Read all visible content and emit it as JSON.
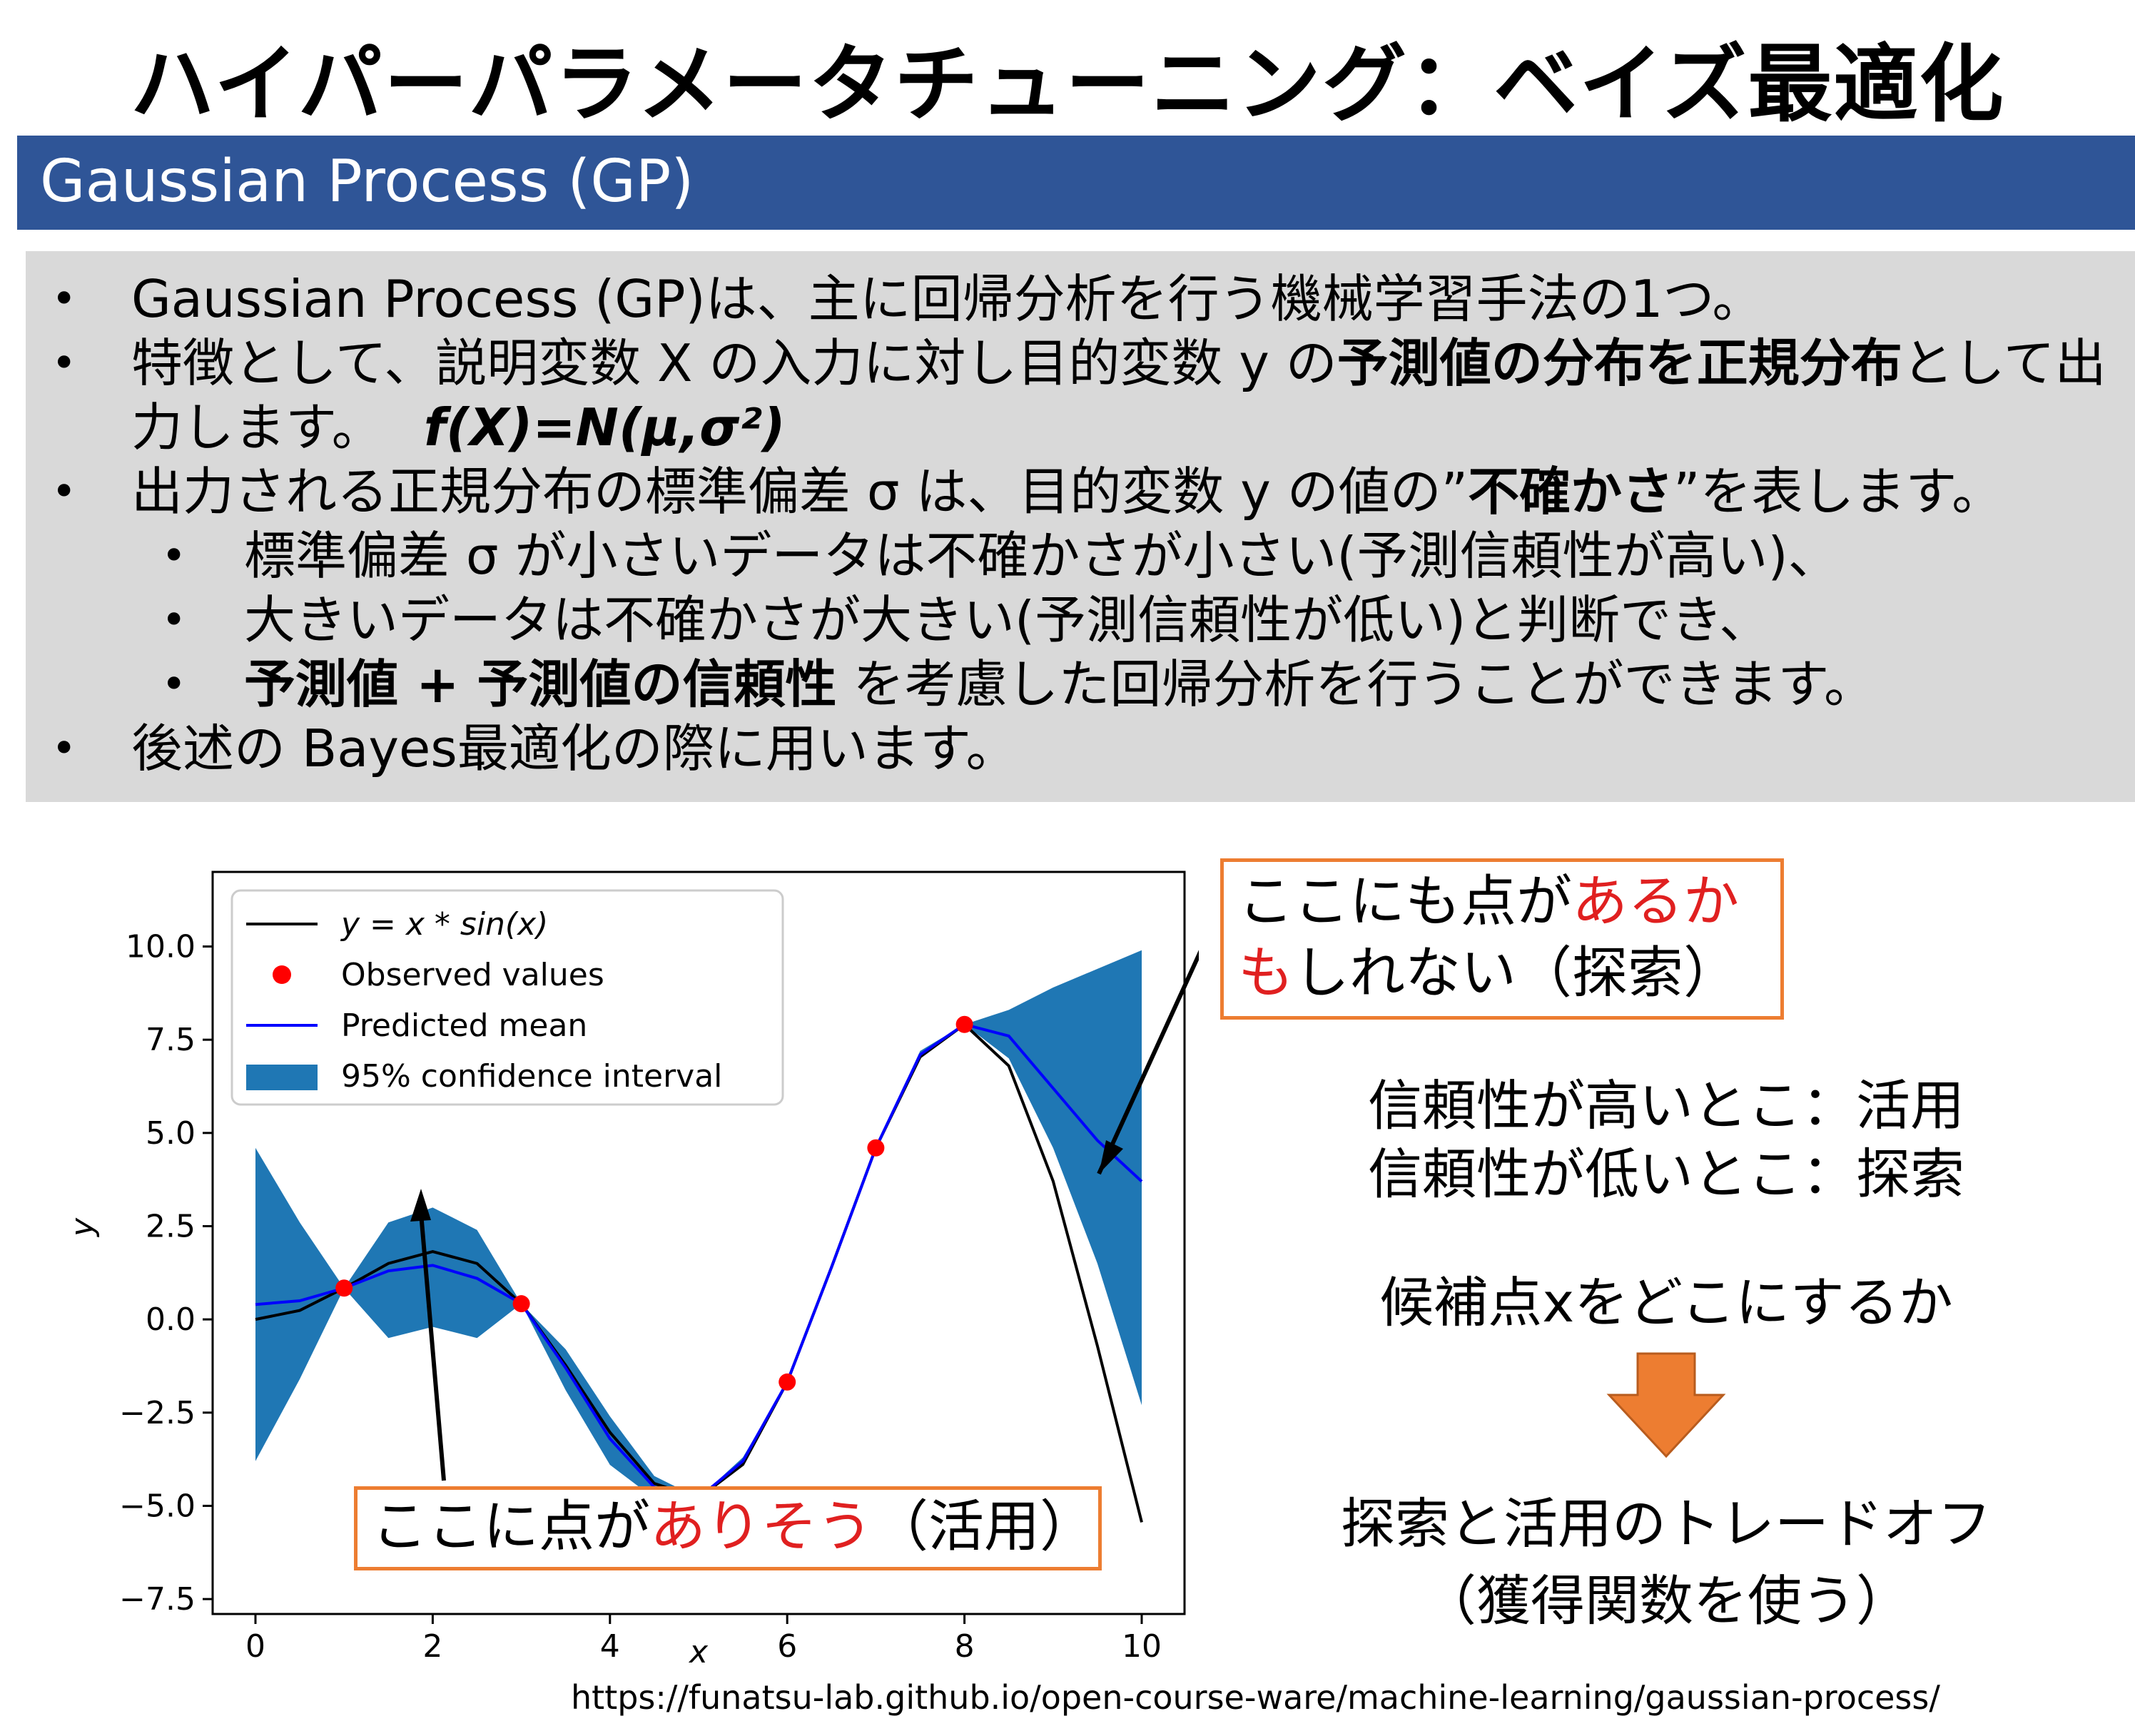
{
  "title": "ハイパーパラメータチューニング：ベイズ最適化",
  "section_title": "Gaussian Process (GP)",
  "bullets": {
    "b1": "Gaussian Process (GP)は、主に回帰分析を行う機械学習手法の1つ。",
    "b2_pre": "特徴として、説明変数 X の入力に対し目的変数 y の",
    "b2_bold": "予測値の分布を正規分布",
    "b2_post": "として出",
    "b2_line2_pre": "力します。",
    "b2_formula": "f(X)=N(μ,σ²)",
    "b3_pre": "出力される正規分布の標準偏差 σ は、目的変数 y の値の”",
    "b3_bold": "不確かさ",
    "b3_post": "”を表します。",
    "s1": "標準偏差 σ が小さいデータは不確かさが小さい(予測信頼性が高い)、",
    "s2": "大きいデータは不確かさが大きい(予測信頼性が低い)と判断でき、",
    "s3_bold": "予測値 + 予測値の信頼性",
    "s3_post": " を考慮した回帰分析を行うことができます。",
    "b4": "後述の Bayes最適化の際に用います。",
    "bullet_char": "•"
  },
  "annotations": {
    "explore_pre": "ここにも点が",
    "explore_red1": "あるか",
    "explore_red2": "も",
    "explore_post": "しれない（探索）",
    "exploit_pre": "ここに点が",
    "exploit_red": "ありそう",
    "exploit_post": "（活用）"
  },
  "side_text": {
    "line1": "信頼性が高いとこ：活用",
    "line2": "信頼性が低いとこ：探索",
    "question": "候補点xをどこにするか",
    "tradeoff": "探索と活用のトレードオフ",
    "acq": "（獲得関数を使う）"
  },
  "url": "https://funatsu-lab.github.io/open-course-ware/machine-learning/gaussian-process/",
  "colors": {
    "header_bar": "#2f5597",
    "bullet_bg": "#d9d9d9",
    "accent_orange": "#ed7d31",
    "highlight_red": "#e02020",
    "ci_fill": "#1f77b4",
    "mean_line": "#0000ff",
    "obs_dot": "#ff0000"
  },
  "chart_data": {
    "type": "line",
    "xlabel": "x",
    "ylabel": "y",
    "xlim": [
      0,
      10
    ],
    "ylim": [
      -7.9,
      12
    ],
    "xticks": [
      "0",
      "2",
      "4",
      "6",
      "8",
      "10"
    ],
    "yticks": [
      "10.0",
      "7.5",
      "5.0",
      "2.5",
      "0.0",
      "−2.5",
      "−5.0",
      "−7.5"
    ],
    "legend_position": "top-left",
    "series": [
      {
        "name": "y = x * sin(x)",
        "kind": "line",
        "color": "#000000",
        "x": [
          0,
          0.5,
          1,
          1.5,
          2,
          2.5,
          3,
          3.5,
          4,
          4.5,
          5,
          5.5,
          6,
          6.5,
          7,
          7.5,
          8,
          8.5,
          9,
          9.5,
          10
        ],
        "y": [
          0,
          0.24,
          0.84,
          1.5,
          1.82,
          1.5,
          0.42,
          -1.23,
          -3.03,
          -4.4,
          -4.79,
          -3.89,
          -1.68,
          1.4,
          4.6,
          7.04,
          7.91,
          6.8,
          3.71,
          -0.71,
          -5.44
        ]
      },
      {
        "name": "Observed values",
        "kind": "scatter",
        "color": "#ff0000",
        "x": [
          1,
          3,
          5,
          6,
          7,
          8
        ],
        "y": [
          0.84,
          0.42,
          -4.79,
          -1.68,
          4.6,
          7.91
        ]
      },
      {
        "name": "Predicted mean",
        "kind": "line",
        "color": "#0000ff",
        "x": [
          0,
          0.5,
          1,
          1.5,
          2,
          2.5,
          3,
          3.5,
          4,
          4.5,
          5,
          5.5,
          6,
          6.5,
          7,
          7.5,
          8,
          8.5,
          9,
          9.5,
          10
        ],
        "y": [
          0.4,
          0.5,
          0.84,
          1.3,
          1.45,
          1.1,
          0.42,
          -1.3,
          -3.2,
          -4.5,
          -4.79,
          -3.8,
          -1.68,
          1.4,
          4.6,
          7.1,
          7.91,
          7.6,
          6.2,
          4.8,
          3.7
        ]
      },
      {
        "name": "95% confidence interval",
        "kind": "band",
        "color": "#1f77b4",
        "x": [
          0,
          0.5,
          1,
          1.5,
          2,
          2.5,
          3,
          3.5,
          4,
          4.5,
          5,
          5.5,
          6,
          6.5,
          7,
          7.5,
          8,
          8.5,
          9,
          9.5,
          10
        ],
        "lower": [
          -3.8,
          -1.6,
          0.84,
          -0.5,
          -0.2,
          -0.5,
          0.42,
          -1.9,
          -3.9,
          -4.8,
          -4.79,
          -3.9,
          -1.68,
          1.35,
          4.6,
          7.0,
          7.91,
          7.0,
          4.6,
          1.5,
          -2.3
        ],
        "upper": [
          4.6,
          2.6,
          0.84,
          2.6,
          3.0,
          2.4,
          0.42,
          -0.8,
          -2.6,
          -4.2,
          -4.79,
          -3.7,
          -1.68,
          1.45,
          4.6,
          7.2,
          7.91,
          8.3,
          8.9,
          9.4,
          9.9
        ]
      }
    ]
  }
}
